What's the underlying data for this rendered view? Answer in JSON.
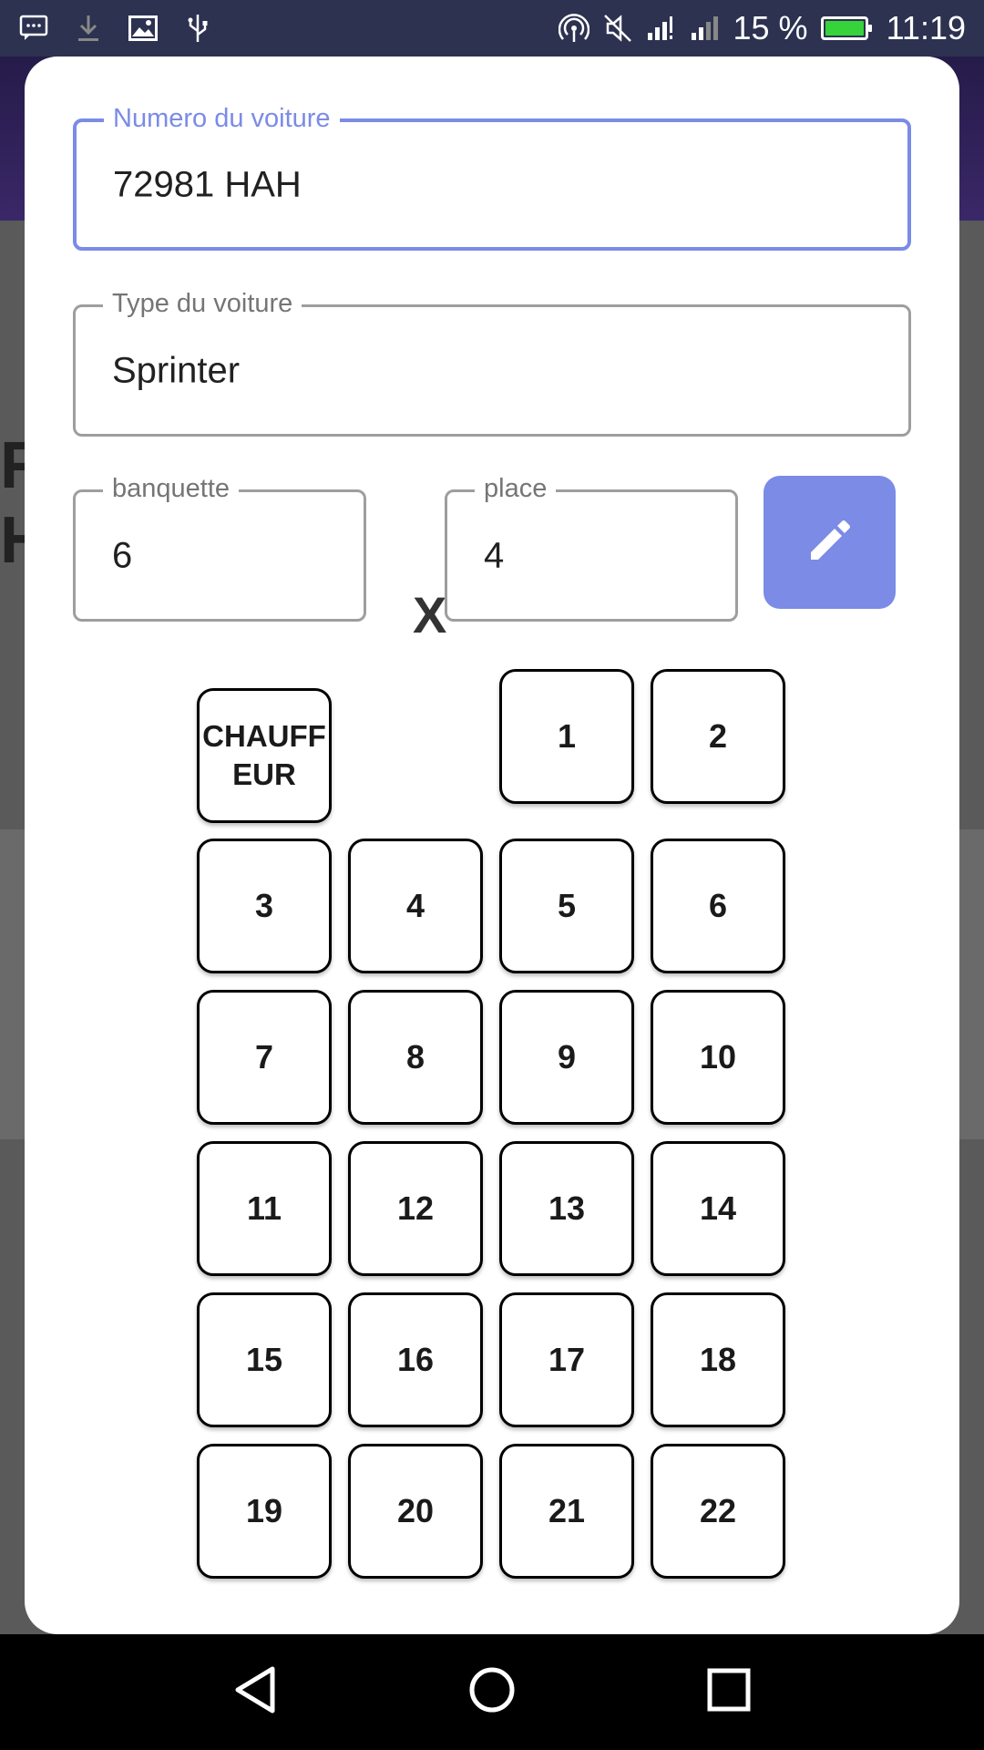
{
  "status_bar": {
    "left_icons": [
      "message-icon",
      "download-icon",
      "image-icon",
      "usb-icon"
    ],
    "right_icons": [
      "hotspot-icon",
      "mute-icon",
      "signal-icon",
      "signal-2-icon"
    ],
    "battery_percent_text": "15 %",
    "battery_level": 0.15,
    "time": "11:19",
    "battery_color": "#37d33a"
  },
  "background": {
    "text_line1": "R",
    "text_line2": "H"
  },
  "form": {
    "car_number": {
      "label": "Numero du voiture",
      "value": "72981 HAH"
    },
    "car_type": {
      "label": "Type du voiture",
      "value": "Sprinter"
    },
    "rows": {
      "label": "banquette",
      "value": "6"
    },
    "seats": {
      "label": "place",
      "value": "4"
    },
    "times_symbol": "X",
    "edit_icon": "pencil-icon"
  },
  "seat_grid": {
    "driver_label": "CHAUFF EUR",
    "seats": [
      "1",
      "2",
      "3",
      "4",
      "5",
      "6",
      "7",
      "8",
      "9",
      "10",
      "11",
      "12",
      "13",
      "14",
      "15",
      "16",
      "17",
      "18",
      "19",
      "20",
      "21",
      "22"
    ]
  },
  "nav_bar": {
    "icons": [
      "back-icon",
      "home-icon",
      "recents-icon"
    ]
  },
  "colors": {
    "accent": "#7b8be6",
    "status_bar": "#2c3250"
  }
}
